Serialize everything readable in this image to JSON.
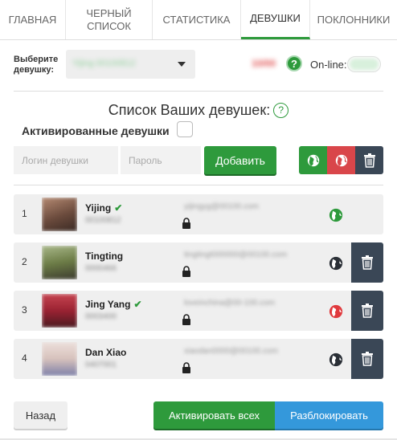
{
  "tabs": [
    {
      "label": "Главная"
    },
    {
      "label": "Черный список"
    },
    {
      "label": "Статистика"
    },
    {
      "label": "Девушки",
      "active": true
    },
    {
      "label": "Поклонники"
    }
  ],
  "selector": {
    "label": "Выберите девушку:",
    "value": "Yijing 00100812"
  },
  "online": {
    "count": "10/00",
    "label": "On-line:"
  },
  "list": {
    "title": "Список Ваших девушек:",
    "help_glyph": "?",
    "activated_label": "Активированные девушки"
  },
  "add_form": {
    "login_placeholder": "Логин девушки",
    "password_placeholder": "Пароль",
    "add_label": "Добавить"
  },
  "girls": [
    {
      "num": "1",
      "name": "Yijing",
      "verified": true,
      "id": "00100812",
      "email": "yijingyg@00100.com",
      "globe": "green",
      "photo_color": "#8a6a5a"
    },
    {
      "num": "2",
      "name": "Tingting",
      "verified": false,
      "id": "0000466",
      "email": "tingtingt000000@00100.com",
      "globe": "dark",
      "photo_color": "#7a8a55"
    },
    {
      "num": "3",
      "name": "Jing Yang",
      "verified": true,
      "id": "0003400",
      "email": "loveinchina@00-100.com",
      "globe": "red",
      "photo_color": "#b8323e"
    },
    {
      "num": "4",
      "name": "Dan Xiao",
      "verified": false,
      "id": "0407001",
      "email": "xiaodan0000@00100.com",
      "globe": "dark",
      "photo_color": "#d9c7c2"
    }
  ],
  "footer": {
    "back_label": "Назад",
    "activate_all_label": "Активировать всех",
    "unblock_label": "Разблокировать"
  },
  "colors": {
    "green": "#2e9a3c",
    "red": "#d9464a",
    "dark": "#3a4756",
    "blue": "#3498db"
  }
}
